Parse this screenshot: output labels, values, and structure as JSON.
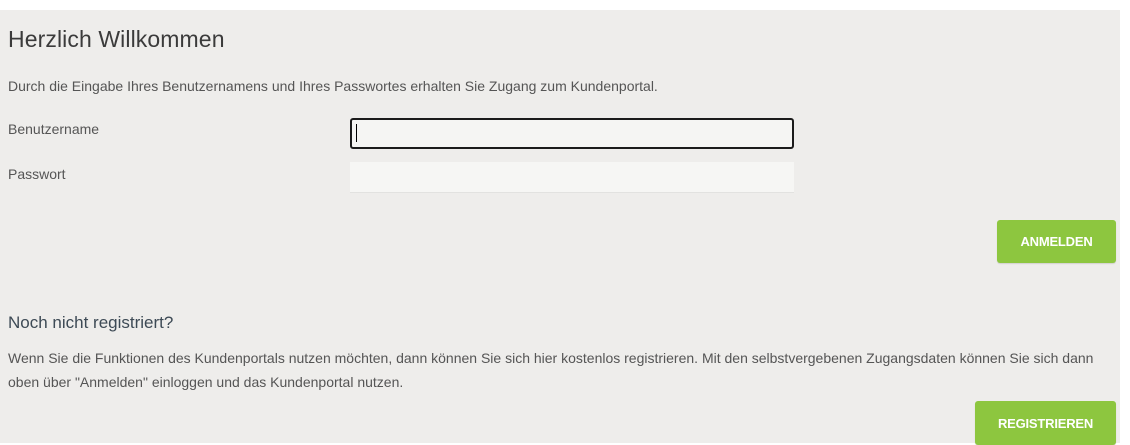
{
  "login": {
    "title": "Herzlich Willkommen",
    "intro": "Durch die Eingabe Ihres Benutzernamens und Ihres Passwortes erhalten Sie Zugang zum Kundenportal.",
    "username_label": "Benutzername",
    "username_value": "",
    "password_label": "Passwort",
    "password_value": "",
    "submit_label": "ANMELDEN"
  },
  "register": {
    "title": "Noch nicht registriert?",
    "text": "Wenn Sie die Funktionen des Kundenportals nutzen möchten, dann können Sie sich hier kostenlos registrieren. Mit den selbstvergebenen Zugangsdaten können Sie sich dann oben über \"Anmelden\" einloggen und das Kundenportal nutzen.",
    "button_label": "REGISTRIEREN"
  },
  "colors": {
    "background": "#eeedeb",
    "accent_green": "#8dc63f",
    "focus_border": "#1b1b1b"
  }
}
